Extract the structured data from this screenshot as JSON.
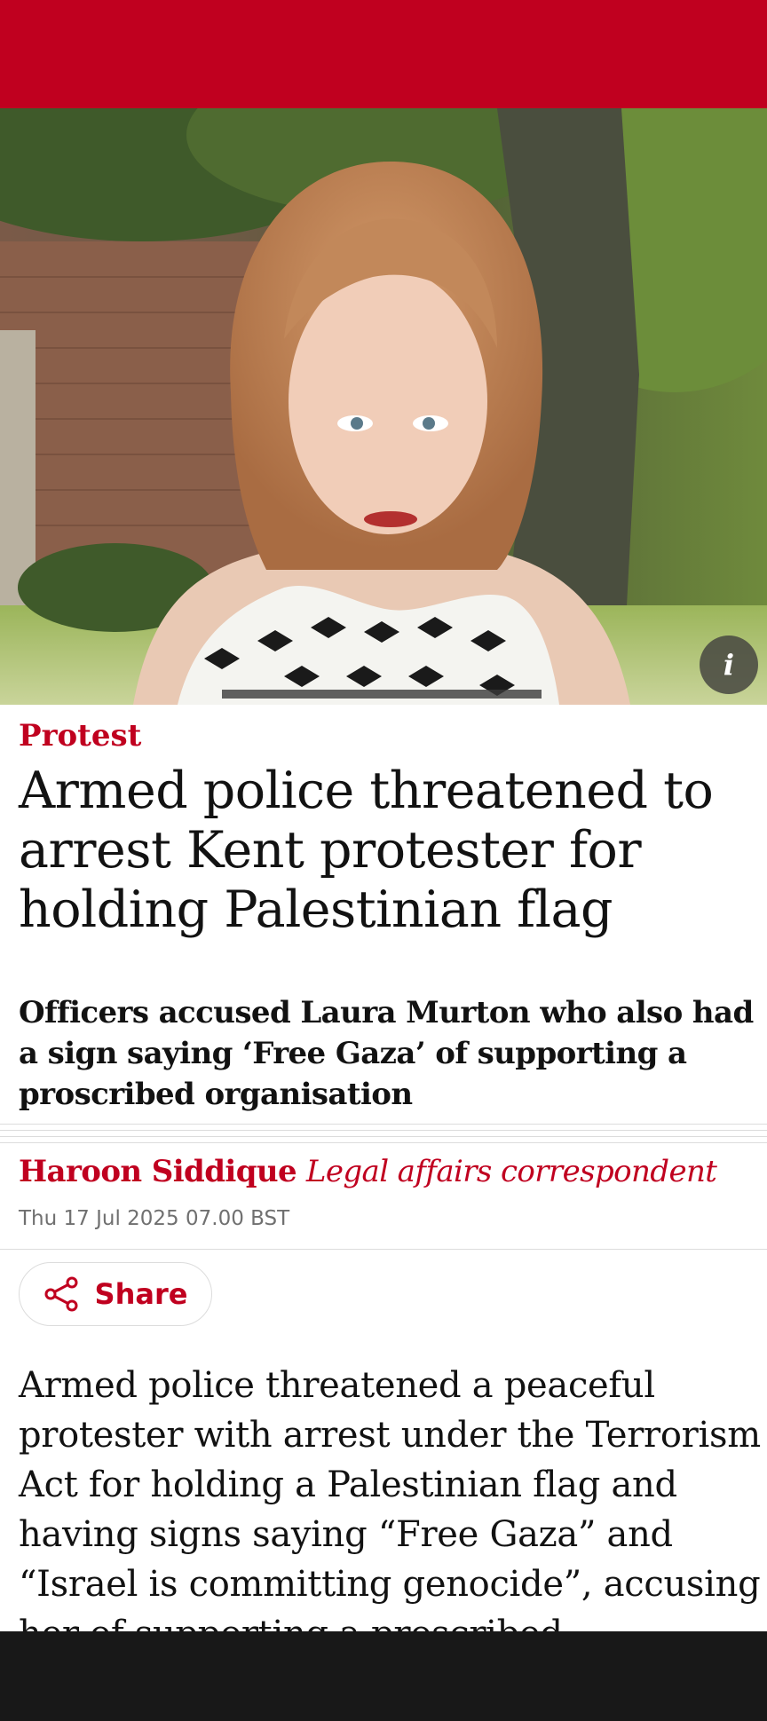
{
  "colors": {
    "brand_red": "#c0001f",
    "headline": "#121212",
    "meta_grey": "#707070",
    "bottom_bar": "#181818"
  },
  "hero": {
    "info_icon": "info-icon",
    "info_label": "i"
  },
  "article": {
    "kicker": "Protest",
    "headline": "Armed police threatened to arrest Kent protester for holding Palestinian flag",
    "standfirst": "Officers accused Laura Murton who also had a sign saying ‘Free Gaza’ of supporting a proscribed organisation",
    "author": "Haroon Siddique",
    "author_role": "Legal affairs correspondent",
    "date": "Thu 17 Jul 2025 07.00 BST",
    "share_label": "Share",
    "share_icon": "share-icon",
    "body_first_paragraph": "Armed police threatened a peaceful protester with arrest under the Terrorism Act for holding a Palestinian flag and having signs saying “Free Gaza” and “Israel is committing genocide”, accusing her of supporting a proscribed organisation"
  }
}
